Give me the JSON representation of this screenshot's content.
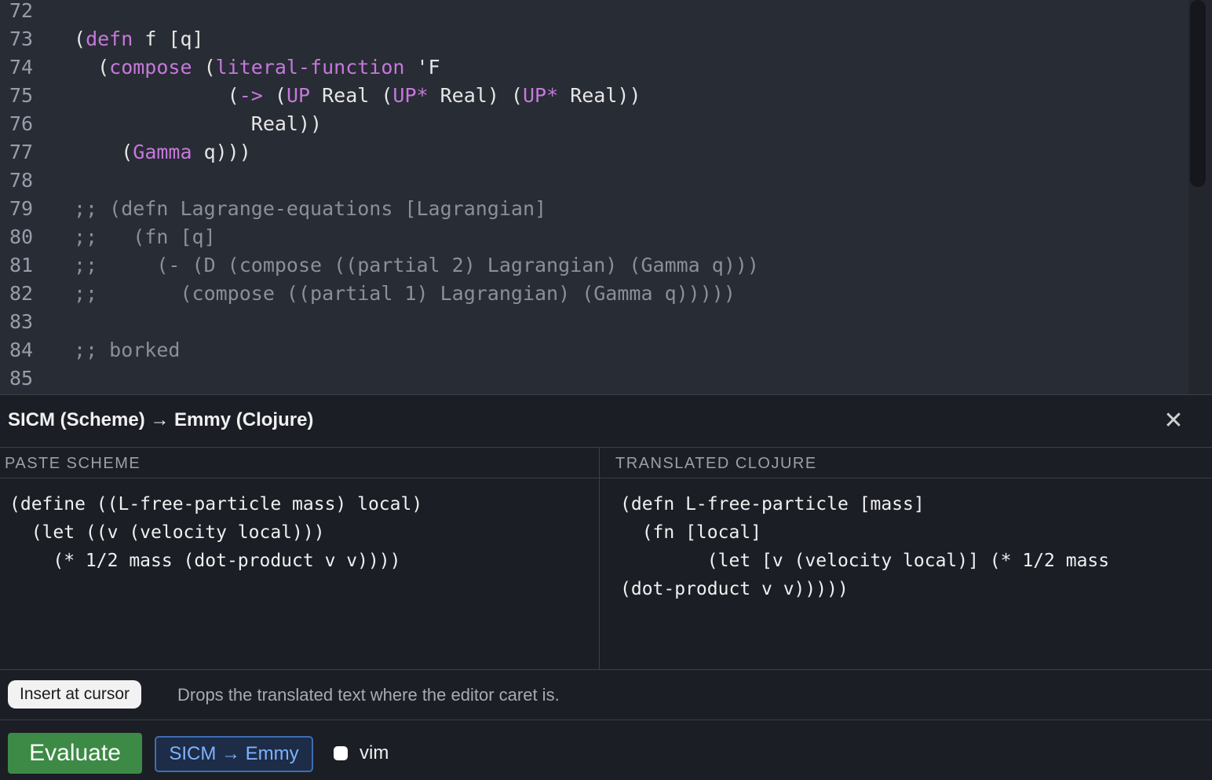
{
  "editor": {
    "lines": [
      {
        "num": "72",
        "segments": []
      },
      {
        "num": "73",
        "segments": [
          {
            "t": "(",
            "c": ""
          },
          {
            "t": "defn",
            "c": "kw"
          },
          {
            "t": " f [q]",
            "c": ""
          }
        ]
      },
      {
        "num": "74",
        "segments": [
          {
            "t": "  (",
            "c": ""
          },
          {
            "t": "compose",
            "c": "kw"
          },
          {
            "t": " (",
            "c": ""
          },
          {
            "t": "literal-function",
            "c": "kw"
          },
          {
            "t": " 'F",
            "c": ""
          }
        ]
      },
      {
        "num": "75",
        "segments": [
          {
            "t": "             (",
            "c": ""
          },
          {
            "t": "->",
            "c": "kw"
          },
          {
            "t": " (",
            "c": ""
          },
          {
            "t": "UP",
            "c": "kw"
          },
          {
            "t": " Real (",
            "c": ""
          },
          {
            "t": "UP*",
            "c": "kw"
          },
          {
            "t": " Real) (",
            "c": ""
          },
          {
            "t": "UP*",
            "c": "kw"
          },
          {
            "t": " Real))",
            "c": ""
          }
        ]
      },
      {
        "num": "76",
        "segments": [
          {
            "t": "               Real))",
            "c": ""
          }
        ]
      },
      {
        "num": "77",
        "segments": [
          {
            "t": "    (",
            "c": ""
          },
          {
            "t": "Gamma",
            "c": "kw"
          },
          {
            "t": " q)))",
            "c": ""
          }
        ]
      },
      {
        "num": "78",
        "segments": []
      },
      {
        "num": "79",
        "segments": [
          {
            "t": ";; (defn Lagrange-equations [Lagrangian]",
            "c": "cmt"
          }
        ]
      },
      {
        "num": "80",
        "segments": [
          {
            "t": ";;   (fn [q]",
            "c": "cmt"
          }
        ]
      },
      {
        "num": "81",
        "segments": [
          {
            "t": ";;     (- (D (compose ((partial 2) Lagrangian) (Gamma q)))",
            "c": "cmt"
          }
        ]
      },
      {
        "num": "82",
        "segments": [
          {
            "t": ";;       (compose ((partial 1) Lagrangian) (Gamma q)))))",
            "c": "cmt"
          }
        ]
      },
      {
        "num": "83",
        "segments": []
      },
      {
        "num": "84",
        "segments": [
          {
            "t": ";; borked",
            "c": "cmt"
          }
        ]
      },
      {
        "num": "85",
        "segments": []
      }
    ]
  },
  "panel": {
    "title": "SICM (Scheme) → Emmy (Clojure)",
    "close_icon": "✕",
    "left": {
      "header": "PASTE SCHEME",
      "code": "(define ((L-free-particle mass) local)\n  (let ((v (velocity local)))\n    (* 1/2 mass (dot-product v v))))"
    },
    "right": {
      "header": "TRANSLATED CLOJURE",
      "code": "(defn L-free-particle [mass]\n  (fn [local]\n        (let [v (velocity local)] (* 1/2 mass\n(dot-product v v)))))"
    },
    "insert_label": "Insert at cursor",
    "insert_hint": "Drops the translated text where the editor caret is."
  },
  "footer": {
    "evaluate_label": "Evaluate",
    "sicm_label": "SICM → Emmy",
    "vim_label": "vim",
    "vim_checked": false
  },
  "colors": {
    "keyword": "#c678dd",
    "comment": "#8a8f99",
    "evaluate_bg": "#3c8a45",
    "sicm_border": "#3f6db3"
  }
}
